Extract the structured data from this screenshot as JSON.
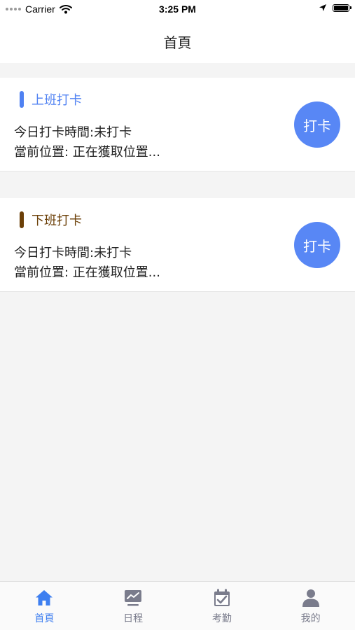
{
  "status_bar": {
    "carrier": "Carrier",
    "time": "3:25 PM",
    "icons": [
      "signal-dots-icon",
      "wifi-icon",
      "location-arrow-icon",
      "battery-icon"
    ]
  },
  "nav": {
    "title": "首頁"
  },
  "cards": [
    {
      "title": "上班打卡",
      "accent_color": "#4f81f2",
      "title_color": "#4f81f2",
      "time_line": "今日打卡時間:未打卡",
      "location_line": "當前位置: 正在獲取位置...",
      "button_label": "打卡"
    },
    {
      "title": "下班打卡",
      "accent_color": "#6b3f07",
      "title_color": "#6b3f07",
      "time_line": "今日打卡時間:未打卡",
      "location_line": "當前位置: 正在獲取位置...",
      "button_label": "打卡"
    }
  ],
  "colors": {
    "button": "#5887f5",
    "tab_active": "#3e7ff0",
    "tab_inactive": "#7a7c8c",
    "page_background": "#f4f4f4"
  },
  "tabs": [
    {
      "label": "首頁",
      "icon": "home-icon",
      "active": true
    },
    {
      "label": "日程",
      "icon": "schedule-chart-icon",
      "active": false
    },
    {
      "label": "考勤",
      "icon": "calendar-check-icon",
      "active": false
    },
    {
      "label": "我的",
      "icon": "user-icon",
      "active": false
    }
  ]
}
